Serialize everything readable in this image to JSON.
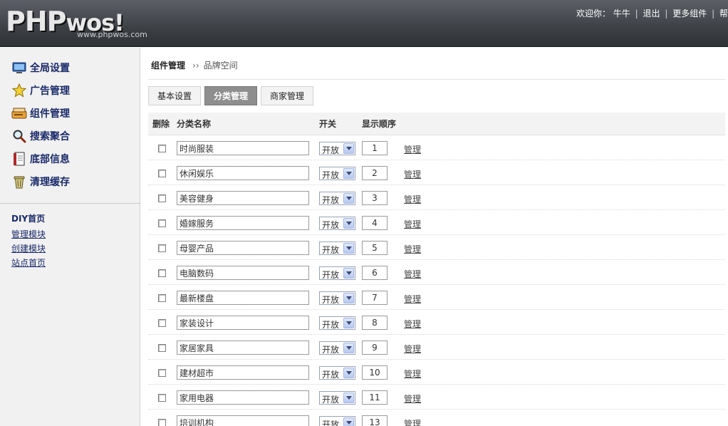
{
  "header": {
    "logo_main": "PHP",
    "logo_wos": "wos!",
    "logo_sub": "www.phpwos.com",
    "welcome": "欢迎你：",
    "username": "牛牛",
    "links": [
      "退出",
      "更多组件",
      "帮"
    ]
  },
  "sidebar": {
    "items": [
      {
        "label": "全局设置",
        "icon": "monitor-icon"
      },
      {
        "label": "广告管理",
        "icon": "star-icon"
      },
      {
        "label": "组件管理",
        "icon": "drive-icon"
      },
      {
        "label": "搜索聚合",
        "icon": "magnifier-icon"
      },
      {
        "label": "底部信息",
        "icon": "document-icon"
      },
      {
        "label": "清理缓存",
        "icon": "trash-icon"
      }
    ],
    "diy_title": "DIY首页",
    "diy_links": [
      "管理模块",
      "创建模块",
      "站点首页"
    ]
  },
  "breadcrumb": {
    "root": "组件管理",
    "sep": "››",
    "current": "品牌空间"
  },
  "tabs": [
    {
      "label": "基本设置",
      "active": false
    },
    {
      "label": "分类管理",
      "active": true
    },
    {
      "label": "商家管理",
      "active": false
    }
  ],
  "table": {
    "headers": {
      "delete": "删除",
      "name": "分类名称",
      "switch": "开关",
      "order": "显示顺序"
    },
    "rows": [
      {
        "name": "时尚服装",
        "switch": "开放",
        "order": "1",
        "action": "管理"
      },
      {
        "name": "休闲娱乐",
        "switch": "开放",
        "order": "2",
        "action": "管理"
      },
      {
        "name": "美容健身",
        "switch": "开放",
        "order": "3",
        "action": "管理"
      },
      {
        "name": "婚嫁服务",
        "switch": "开放",
        "order": "4",
        "action": "管理"
      },
      {
        "name": "母婴产品",
        "switch": "开放",
        "order": "5",
        "action": "管理"
      },
      {
        "name": "电脑数码",
        "switch": "开放",
        "order": "6",
        "action": "管理"
      },
      {
        "name": "最新楼盘",
        "switch": "开放",
        "order": "7",
        "action": "管理"
      },
      {
        "name": "家装设计",
        "switch": "开放",
        "order": "8",
        "action": "管理"
      },
      {
        "name": "家居家具",
        "switch": "开放",
        "order": "9",
        "action": "管理"
      },
      {
        "name": "建材超市",
        "switch": "开放",
        "order": "10",
        "action": "管理"
      },
      {
        "name": "家用电器",
        "switch": "开放",
        "order": "11",
        "action": "管理"
      },
      {
        "name": "培训机构",
        "switch": "开放",
        "order": "13",
        "action": "管理"
      }
    ]
  }
}
